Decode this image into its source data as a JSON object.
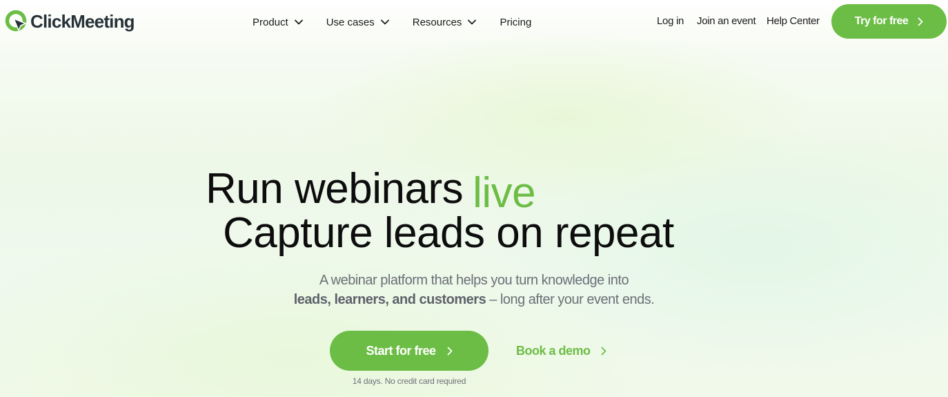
{
  "brand": {
    "name": "ClickMeeting",
    "color": "#6cbd45",
    "logo_icon": "clickmeeting-logo-icon"
  },
  "nav": {
    "items": [
      {
        "label": "Product",
        "icon": "chevron-down-icon"
      },
      {
        "label": "Use cases",
        "icon": "chevron-down-icon"
      },
      {
        "label": "Resources",
        "icon": "chevron-down-icon"
      },
      {
        "label": "Pricing"
      }
    ]
  },
  "header_links": {
    "login": "Log in",
    "join": "Join an event",
    "help": "Help Center",
    "try_label": "Try for free",
    "try_icon": "chevron-right-icon"
  },
  "hero": {
    "line1_main": "Run webinars",
    "line1_accent": "live",
    "line2": "Capture leads on repeat",
    "sub_line1": "A webinar platform that helps you turn knowledge into",
    "sub_line2_bold": "leads, learners, and customers",
    "sub_line2_rest": " – long after your event ends.",
    "start_label": "Start for free",
    "demo_label": "Book a demo",
    "note": "14 days. No credit card required"
  }
}
